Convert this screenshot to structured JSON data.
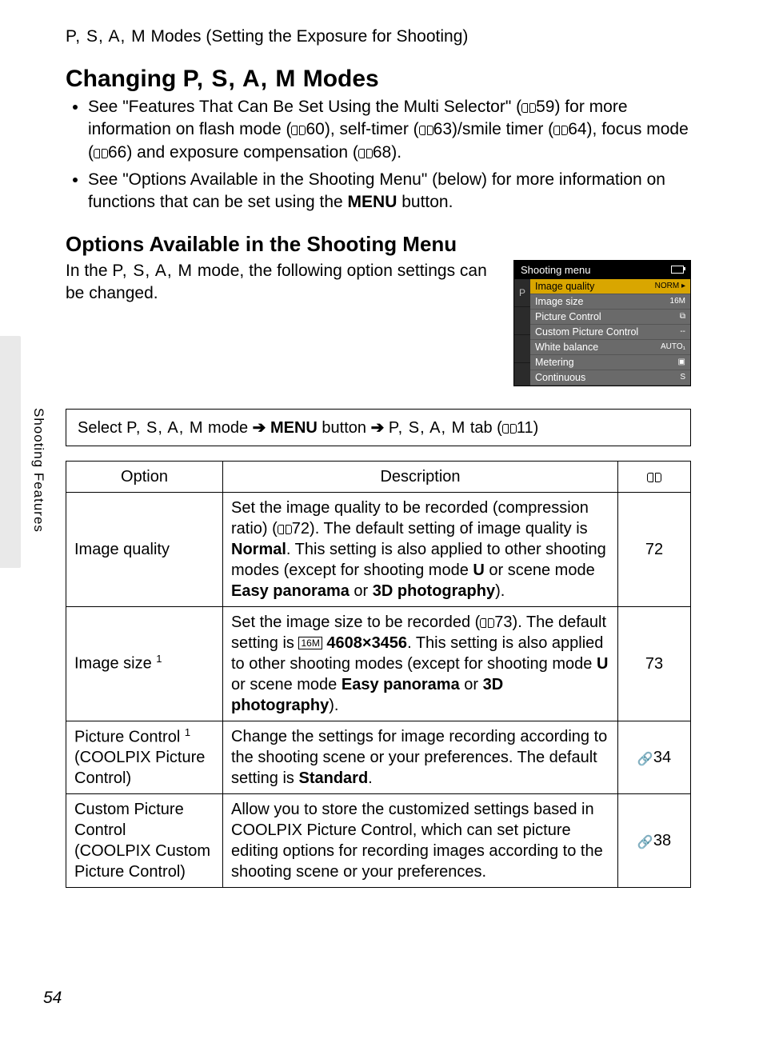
{
  "header": {
    "modes": "P, S, A, M",
    "title_rest": " Modes (Setting the Exposure for Shooting)"
  },
  "main_title": {
    "prefix": "Changing ",
    "modes": "P, S, A, M",
    "suffix": " Modes"
  },
  "bullets": [
    {
      "parts": [
        "See \"Features That Can Be Set Using the Multi Selector\" (",
        "59) for more information on flash mode (",
        "60), self-timer (",
        "63)/smile timer (",
        "64), focus mode (",
        "66) and exposure compensation (",
        "68)."
      ]
    },
    {
      "text_a": "See \"Options Available in the Shooting Menu\" (below) for more information on functions that can be set using the ",
      "menu": "MENU",
      "text_b": " button."
    }
  ],
  "subhead": "Options Available in the Shooting Menu",
  "intro": {
    "a": "In the ",
    "modes": "P, S, A, M",
    "b": " mode, the following option settings can be changed."
  },
  "mini_screen": {
    "title": "Shooting menu",
    "tabs": [
      "P",
      "",
      ""
    ],
    "rows": [
      {
        "label": "Image quality",
        "val": "NORM ▸",
        "sel": true
      },
      {
        "label": "Image size",
        "val": "16M"
      },
      {
        "label": "Picture Control",
        "val": "⧉"
      },
      {
        "label": "Custom Picture Control",
        "val": "--"
      },
      {
        "label": "White balance",
        "val": "AUTO₁"
      },
      {
        "label": "Metering",
        "val": "▣"
      },
      {
        "label": "Continuous",
        "val": "S"
      }
    ]
  },
  "instruction": {
    "a": "Select ",
    "modes1": "P, S, A, M",
    "b": " mode ",
    "menu": "MENU",
    "c": " button ",
    "modes2": "P, S, A, M",
    "d": " tab (",
    "page": "11)"
  },
  "table": {
    "head": {
      "c1": "Option",
      "c2": "Description"
    },
    "rows": [
      {
        "option": "Image quality",
        "desc_a": "Set the image quality to be recorded (compression ratio) (",
        "desc_p1": "72). The default setting of image quality is ",
        "desc_b1": "Normal",
        "desc_c": ". This setting is also applied to other shooting modes (except for shooting mode ",
        "u": "U",
        "desc_d": " or scene mode ",
        "desc_b2": "Easy panorama",
        "desc_e": " or ",
        "desc_b3": "3D photography",
        "desc_f": ").",
        "page": "72",
        "pagetype": "num"
      },
      {
        "option_html": "Image size ",
        "sup": "1",
        "desc_a": "Set the image size to be recorded (",
        "desc_p1": "73). The default setting is ",
        "sizeicon": "16M",
        "desc_b1": "4608×3456",
        "desc_c": ". This setting is also applied to other shooting modes (except for shooting mode ",
        "u": "U",
        "desc_d": " or scene mode ",
        "desc_b2": "Easy panorama",
        "desc_e": " or ",
        "desc_b3": "3D photography",
        "desc_f": ").",
        "page": "73",
        "pagetype": "num"
      },
      {
        "option_l1": "Picture Control ",
        "sup": "1",
        "option_l2": "(COOLPIX Picture Control)",
        "desc_a": "Change the settings for image recording according to the shooting scene or your preferences. The default setting is ",
        "desc_b1": "Standard",
        "desc_f": ".",
        "page": "34",
        "pagetype": "link"
      },
      {
        "option_full": "Custom Picture Control\n(COOLPIX Custom Picture Control)",
        "desc_full": "Allow you to store the customized settings based in COOLPIX Picture Control, which can set picture editing options for recording images according to the shooting scene or your preferences.",
        "page": "38",
        "pagetype": "link"
      }
    ]
  },
  "side_tab": "Shooting Features",
  "page_number": "54"
}
